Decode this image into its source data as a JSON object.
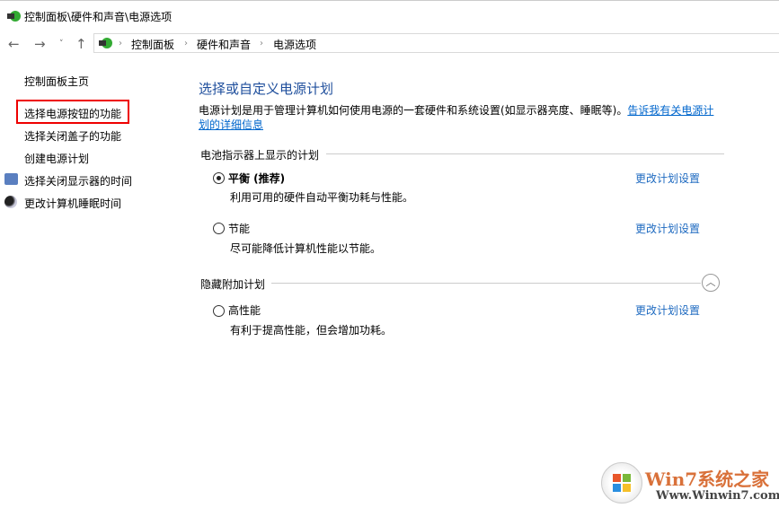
{
  "window": {
    "title": "控制面板\\硬件和声音\\电源选项"
  },
  "address": {
    "crumbs": [
      "控制面板",
      "硬件和声音",
      "电源选项"
    ]
  },
  "sidebar": {
    "home": "控制面板主页",
    "items": [
      "选择电源按钮的功能",
      "选择关闭盖子的功能",
      "创建电源计划",
      "选择关闭显示器的时间",
      "更改计算机睡眠时间"
    ]
  },
  "main": {
    "title": "选择或自定义电源计划",
    "description": "电源计划是用于管理计算机如何使用电源的一套硬件和系统设置(如显示器亮度、睡眠等)。",
    "description_link": "告诉我有关电源计划的详细信息",
    "group1": "电池指示器上显示的计划",
    "group2": "隐藏附加计划",
    "plans": [
      {
        "name": "平衡 (推荐)",
        "desc": "利用可用的硬件自动平衡功耗与性能。",
        "link": "更改计划设置",
        "selected": true
      },
      {
        "name": "节能",
        "desc": "尽可能降低计算机性能以节能。",
        "link": "更改计划设置",
        "selected": false
      },
      {
        "name": "高性能",
        "desc": "有利于提高性能，但会增加功耗。",
        "link": "更改计划设置",
        "selected": false
      }
    ]
  },
  "watermark": {
    "brand": "Win7系统之家",
    "url": "Www.Winwin7.com"
  },
  "colors": {
    "highlight": "#ee0000",
    "link": "#0066cc",
    "title": "#1e4e9c"
  }
}
